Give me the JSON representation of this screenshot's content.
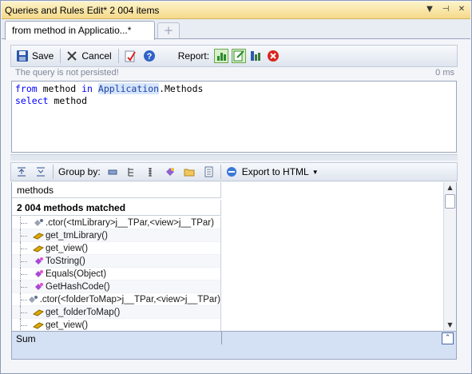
{
  "window": {
    "title": "Queries and Rules Edit*  2 004 items",
    "controls": [
      "dropdown",
      "pin",
      "close"
    ]
  },
  "tabs": {
    "active_label": "from method in Applicatio...*",
    "add_label": "+"
  },
  "toolbar": {
    "save_label": "Save",
    "cancel_label": "Cancel",
    "report_label": "Report:"
  },
  "status": {
    "message": "The query is not persisted!",
    "duration": "0 ms"
  },
  "editor": {
    "line1_kw1": "from",
    "line1_var": " method ",
    "line1_kw2": "in",
    "line1_type": "Application",
    "line1_rest": ".Methods",
    "line2_kw": "select",
    "line2_rest": " method"
  },
  "results_toolbar": {
    "group_by_label": "Group by:",
    "export_label": "Export to HTML"
  },
  "results": {
    "column_header": "methods",
    "matched_label": "2 004 methods matched",
    "rows": [
      {
        "name": ".ctor(<tmLibrary>j__TPar,<view>j__TPar)",
        "icon": "constructor-icon"
      },
      {
        "name": "get_tmLibrary()",
        "icon": "property-getter-icon"
      },
      {
        "name": "get_view()",
        "icon": "property-getter-icon"
      },
      {
        "name": "ToString()",
        "icon": "virtual-method-icon"
      },
      {
        "name": "Equals(Object)",
        "icon": "virtual-method-icon"
      },
      {
        "name": "GetHashCode()",
        "icon": "virtual-method-icon"
      },
      {
        "name": ".ctor(<folderToMap>j__TPar,<view>j__TPar)",
        "icon": "constructor-icon"
      },
      {
        "name": "get_folderToMap()",
        "icon": "property-getter-icon"
      },
      {
        "name": "get_view()",
        "icon": "property-getter-icon"
      }
    ]
  },
  "sum": {
    "label": "Sum"
  }
}
